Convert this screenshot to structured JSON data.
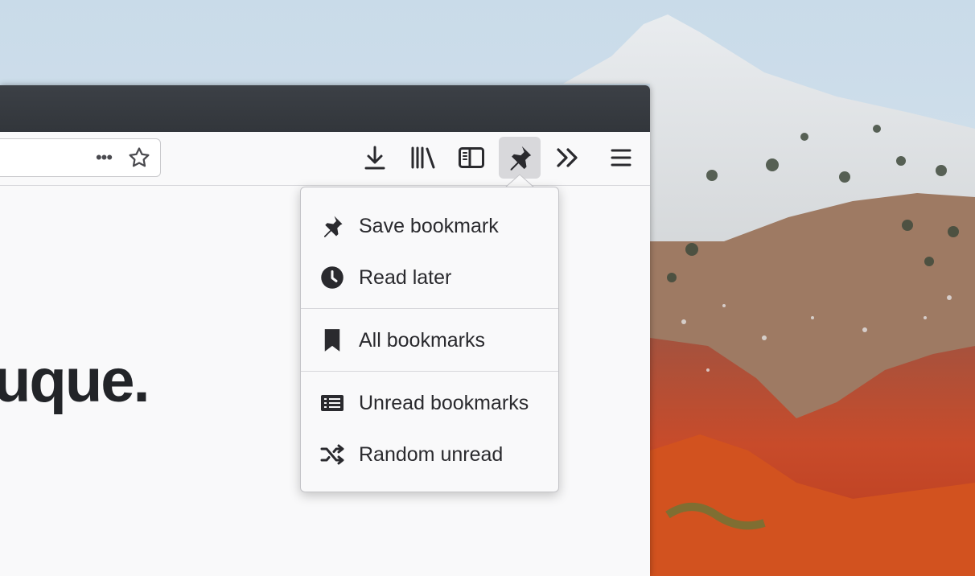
{
  "page_heading": "uque.",
  "urlbar": {
    "page_actions_glyph": "•••"
  },
  "toolbar": {
    "buttons": [
      {
        "icon": "download-icon"
      },
      {
        "icon": "library-icon"
      },
      {
        "icon": "sidebar-icon"
      },
      {
        "icon": "pin-icon",
        "active": true
      },
      {
        "icon": "overflow-chevrons-icon"
      },
      {
        "icon": "hamburger-menu-icon"
      }
    ]
  },
  "menu": {
    "items": [
      {
        "label": "Save bookmark",
        "icon": "pin-icon"
      },
      {
        "label": "Read later",
        "icon": "clock-icon"
      },
      {
        "label": "All bookmarks",
        "icon": "bookmark-icon"
      },
      {
        "label": "Unread bookmarks",
        "icon": "list-icon"
      },
      {
        "label": "Random unread",
        "icon": "shuffle-icon"
      }
    ]
  },
  "colors": {
    "titlebar": "#36393e",
    "toolbar": "#f9f9fa",
    "icon": "#2a2a2e",
    "active_button": "#d8d8db",
    "menu_text": "#2a2a2e"
  }
}
